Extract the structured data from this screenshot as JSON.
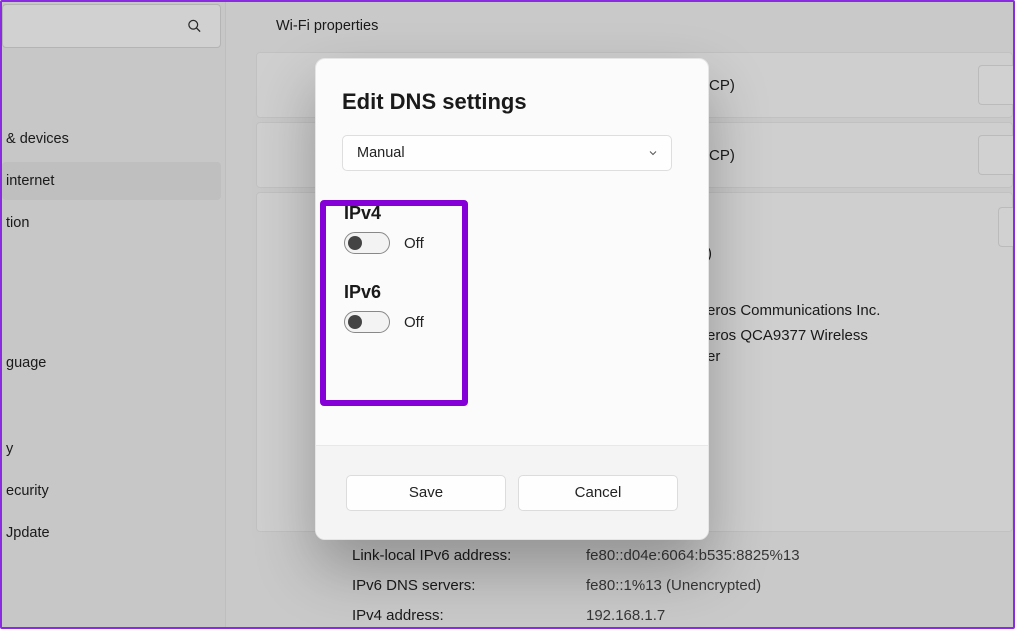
{
  "page": {
    "title": "Wi-Fi properties"
  },
  "sidebar": {
    "items": [
      {
        "label": "& devices"
      },
      {
        "label": "internet"
      },
      {
        "label": "tion"
      },
      {
        "label": "guage"
      },
      {
        "label": "y"
      },
      {
        "label": "ecurity"
      },
      {
        "label": "Jpdate"
      }
    ]
  },
  "cards": {
    "row1_suffix": "CP)",
    "row2_suffix": "CP)",
    "big_paren": ")",
    "big_text_line1": "eros Communications Inc.",
    "big_text_line2a": "eros QCA9377 Wireless",
    "big_text_line2b": "er"
  },
  "properties": [
    {
      "label": "Link-local IPv6 address:",
      "value": "fe80::d04e:6064:b535:8825%13"
    },
    {
      "label": "IPv6 DNS servers:",
      "value": "fe80::1%13 (Unencrypted)"
    },
    {
      "label": "IPv4 address:",
      "value": "192.168.1.7"
    }
  ],
  "modal": {
    "title": "Edit DNS settings",
    "dropdown": "Manual",
    "ipv4": {
      "label": "IPv4",
      "state": "Off"
    },
    "ipv6": {
      "label": "IPv6",
      "state": "Off"
    },
    "save": "Save",
    "cancel": "Cancel"
  }
}
